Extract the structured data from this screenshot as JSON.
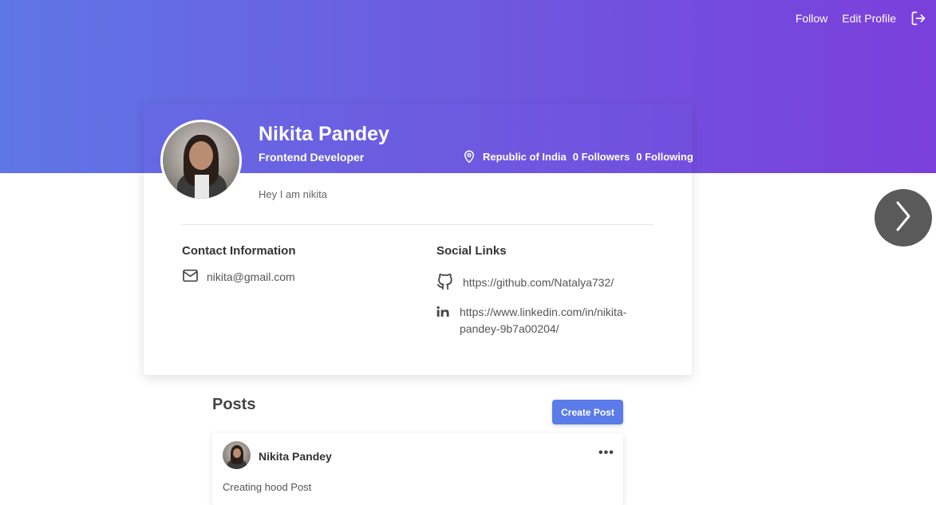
{
  "nav": {
    "follow_label": "Follow",
    "edit_profile_label": "Edit Profile",
    "logout_icon": "logout-icon"
  },
  "profile": {
    "name": "Nikita Pandey",
    "role": "Frontend Developer",
    "location": "Republic of India",
    "followers": "0 Followers",
    "following": "0 Following",
    "bio": "Hey I am nikita"
  },
  "contact": {
    "title": "Contact Information",
    "email": "nikita@gmail.com"
  },
  "social": {
    "title": "Social Links",
    "github": "https://github.com/Natalya732/",
    "linkedin_line1": "https://www.linkedin.com/in/nikita-",
    "linkedin_line2": "pandey-9b7a00204/"
  },
  "posts": {
    "title": "Posts",
    "create_label": "Create Post",
    "items": [
      {
        "author": "Nikita Pandey",
        "menu": "•••",
        "text": "Creating hood Post"
      }
    ]
  },
  "colors": {
    "gradient_start": "#5f76e6",
    "gradient_end": "#7b3fdb",
    "button": "#5a7be8",
    "next_button": "#5a5a5a"
  }
}
